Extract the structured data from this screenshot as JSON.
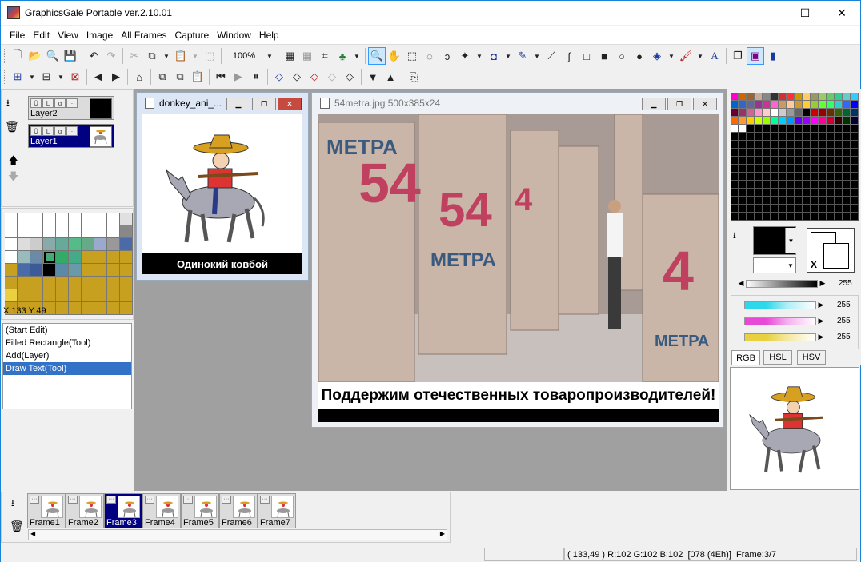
{
  "app": {
    "title": "GraphicsGale Portable ver.2.10.01"
  },
  "window_controls": {
    "minimize": "—",
    "maximize": "☐",
    "close": "✕"
  },
  "menu": [
    "File",
    "Edit",
    "View",
    "Image",
    "All Frames",
    "Capture",
    "Window",
    "Help"
  ],
  "toolbar1": {
    "zoom": "100%"
  },
  "layers": [
    {
      "name": "Layer2",
      "selected": false
    },
    {
      "name": "Layer1",
      "selected": true
    }
  ],
  "palette_panel": {
    "coords": "X:133 Y:49"
  },
  "history": [
    "(Start Edit)",
    "Filled Rectangle(Tool)",
    "Add(Layer)",
    "Draw Text(Tool)"
  ],
  "history_current": 3,
  "doc1": {
    "title": "donkey_ani_...",
    "caption": "Одинокий ковбой"
  },
  "doc2": {
    "title": "54metra.jpg 500x385x24",
    "caption": "Поддержим отечественных товаропроизводителей!"
  },
  "color_panel": {
    "swap_label": "X",
    "gray_value": "255",
    "rgb_values": [
      "255",
      "255",
      "255"
    ],
    "tabs": [
      "RGB",
      "HSL",
      "HSV"
    ]
  },
  "frames": [
    "Frame1",
    "Frame2",
    "Frame3",
    "Frame4",
    "Frame5",
    "Frame6",
    "Frame7"
  ],
  "selected_frame": 2,
  "status": {
    "coords": "( 133,49 )",
    "rgb": "R:102 G:102 B:102",
    "index": "[078 (4Eh)]",
    "frame": "Frame:3/7"
  },
  "colors": {
    "accent": "#1883d7",
    "selection": "#000080",
    "history_sel": "#3373c7"
  }
}
